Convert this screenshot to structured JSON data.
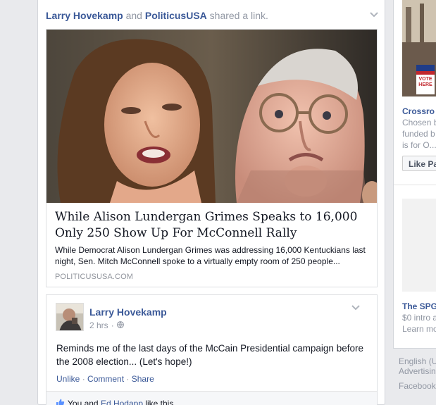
{
  "post": {
    "actor1": "Larry Hovekamp",
    "conj": "and",
    "actor2": "PoliticusUSA",
    "verb": "shared a link."
  },
  "link": {
    "title": "While Alison Lundergan Grimes Speaks to 16,000 Only 250 Show Up For McConnell Rally",
    "description": "While Democrat Alison Lundergan Grimes was addressing 16,000 Kentuckians last night, Sen. Mitch McConnell spoke to a virtually empty room of 250 people...",
    "source": "POLITICUSUSA.COM"
  },
  "share": {
    "author": "Larry Hovekamp",
    "time": "2 hrs",
    "separator": "·",
    "text": "Reminds me of the last days of the McCain Presidential campaign before the 2008 election... (Let's hope!)",
    "actions": {
      "unlike": "Unlike",
      "dot1": " · ",
      "comment": "Comment",
      "dot2": " · ",
      "share": "Share"
    },
    "likes": {
      "you": "You and ",
      "friend": "Ed Hodapp",
      "tail": " like this."
    }
  },
  "rail": {
    "ad1": {
      "sign_line1": "VOTE",
      "sign_line2": "HERE",
      "title": "Crossro",
      "body": [
        "Chosen b",
        "funded b",
        "is for O..."
      ],
      "like_label": "Like Pa"
    },
    "ad2": {
      "title": "The SPG",
      "body": [
        "$0 intro a",
        "Learn mo"
      ]
    },
    "footer": [
      "English (U",
      "Advertisin",
      "Facebook"
    ]
  },
  "icons": {
    "options": "chevron-down-icon",
    "privacy": "globe-icon",
    "like": "thumbs-up-icon"
  },
  "colors": {
    "link_blue": "#3b5998",
    "meta_gray": "#9197a3",
    "page_bg": "#e9eaed"
  }
}
